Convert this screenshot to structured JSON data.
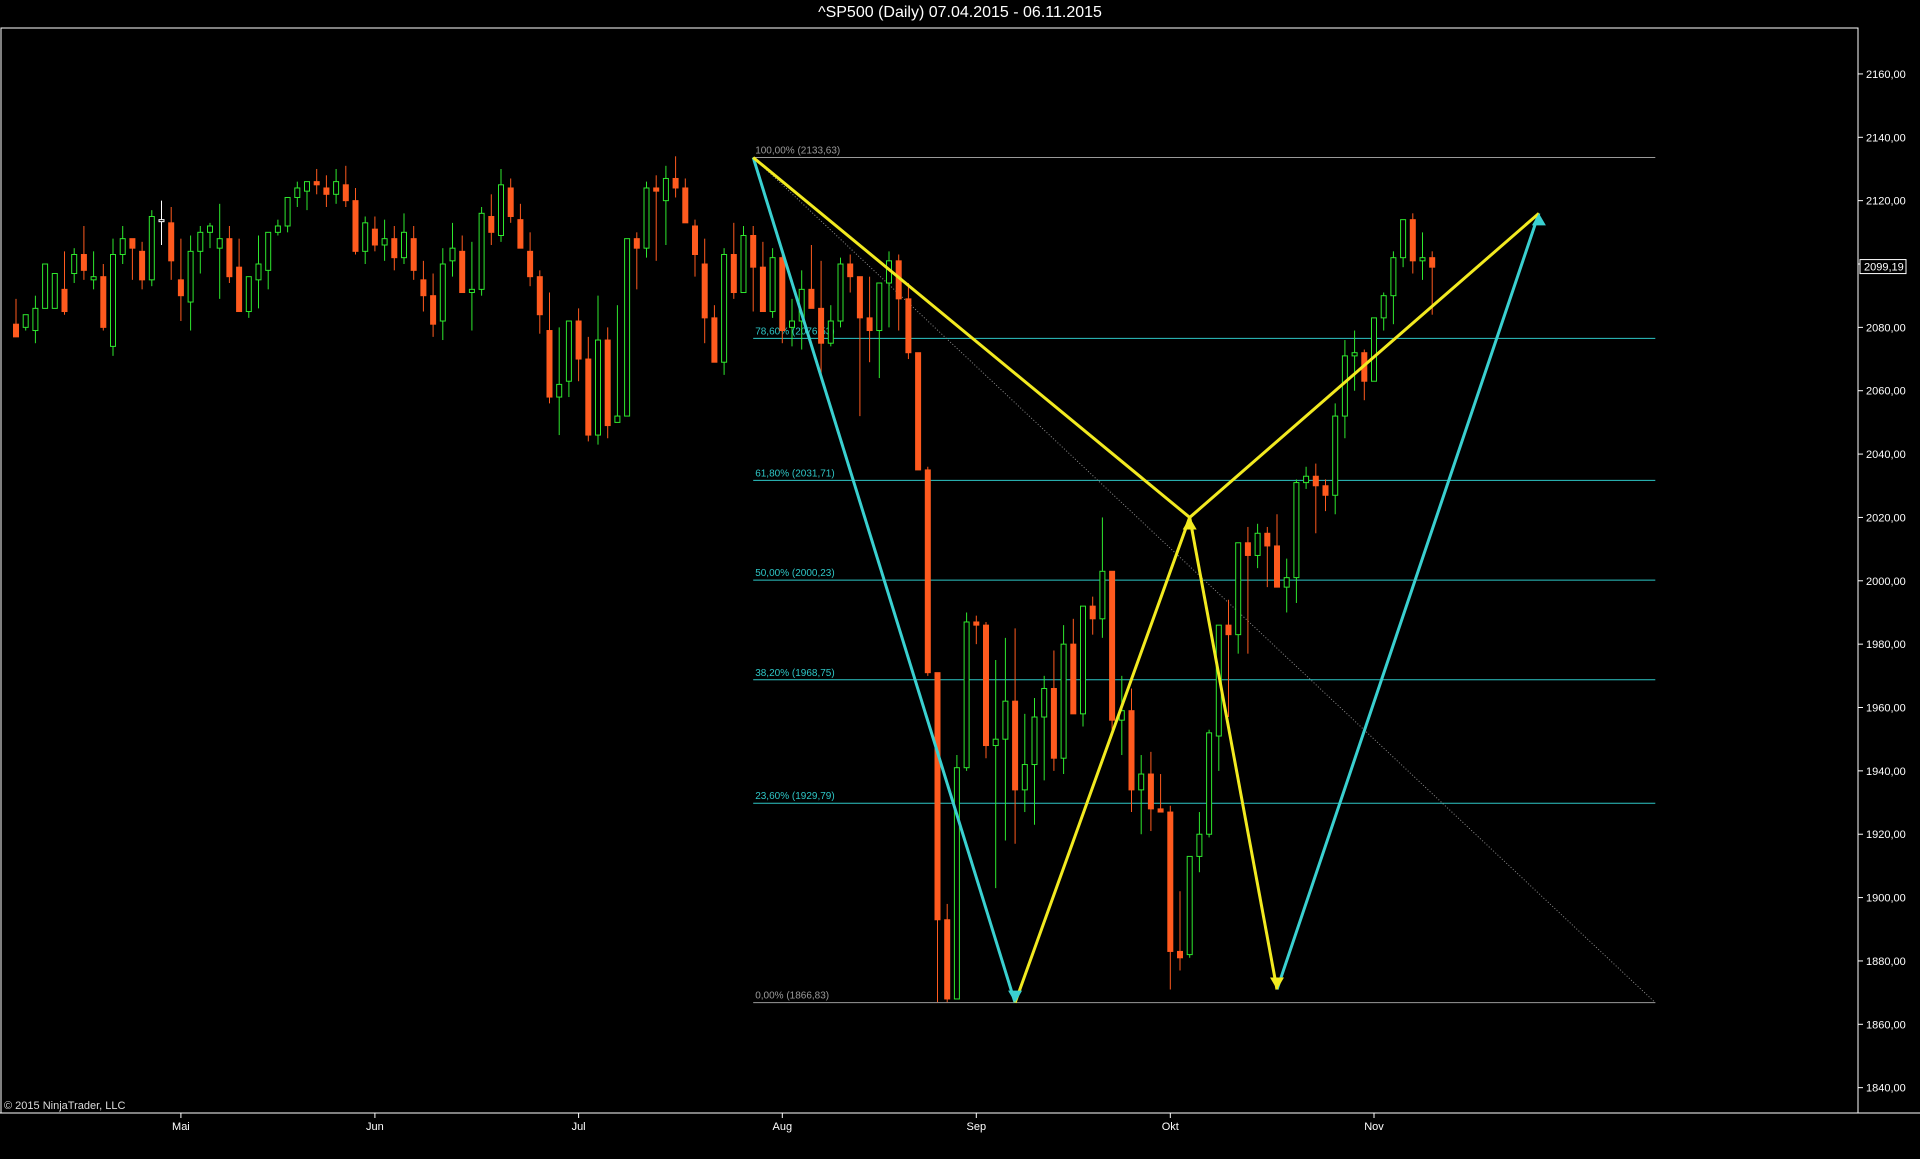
{
  "header": {
    "title": "^SP500 (Daily)  07.04.2015 - 06.11.2015"
  },
  "footer": {
    "copyright": "© 2015 NinjaTrader, LLC"
  },
  "colors": {
    "background": "#000000",
    "up_candle": "#2ee82e",
    "down_candle": "#ff5a1e",
    "doji": "#ffffff",
    "fib_line": "#2ec6c6",
    "fib_extreme_line": "#9a9a9a",
    "pattern_xa": "#3ad0d0",
    "pattern_yellow": "#f2ea20",
    "trend_line": "#8a8a8a",
    "axis": "#ffffff"
  },
  "chart_data": {
    "type": "candlestick",
    "title": "^SP500 (Daily)  07.04.2015 - 06.11.2015",
    "ylim": [
      1830,
      2170
    ],
    "y_ticks": [
      "1840,00",
      "1860,00",
      "1880,00",
      "1900,00",
      "1920,00",
      "1940,00",
      "1960,00",
      "1980,00",
      "2000,00",
      "2020,00",
      "2040,00",
      "2060,00",
      "2080,00",
      "2100,00",
      "2120,00",
      "2140,00",
      "2160,00"
    ],
    "x_ticks": [
      {
        "label": "Mai",
        "bar": 17
      },
      {
        "label": "Jun",
        "bar": 37
      },
      {
        "label": "Jul",
        "bar": 58
      },
      {
        "label": "Aug",
        "bar": 79
      },
      {
        "label": "Sep",
        "bar": 99
      },
      {
        "label": "Okt",
        "bar": 119
      },
      {
        "label": "Nov",
        "bar": 140
      }
    ],
    "last_price_label": "2099,19",
    "last_price": 2099.19,
    "candles": [
      [
        2081,
        2089,
        2079,
        2077
      ],
      [
        2080,
        2082,
        2079,
        2084
      ],
      [
        2079,
        2090,
        2075,
        2086
      ],
      [
        2086,
        2098,
        2086,
        2100
      ],
      [
        2086,
        2096,
        2092,
        2097
      ],
      [
        2092,
        2104,
        2084,
        2085
      ],
      [
        2097,
        2105,
        2094,
        2103
      ],
      [
        2103,
        2112,
        2095,
        2098
      ],
      [
        2095,
        2104,
        2092,
        2096
      ],
      [
        2096,
        2100,
        2079,
        2080
      ],
      [
        2074,
        2108,
        2071,
        2103
      ],
      [
        2103,
        2112,
        2100,
        2108
      ],
      [
        2108,
        2104,
        2095,
        2105
      ],
      [
        2104,
        2107,
        2092,
        2095
      ],
      [
        2095,
        2117,
        2093,
        2115
      ],
      [
        2114,
        2120,
        2106,
        2114
      ],
      [
        2113,
        2118,
        2095,
        2101
      ],
      [
        2095,
        2108,
        2082,
        2090
      ],
      [
        2088,
        2109,
        2079,
        2104
      ],
      [
        2104,
        2112,
        2097,
        2110
      ],
      [
        2110,
        2113,
        2105,
        2112
      ],
      [
        2105,
        2119,
        2089,
        2108
      ],
      [
        2108,
        2112,
        2094,
        2096
      ],
      [
        2099,
        2108,
        2090,
        2085
      ],
      [
        2085,
        2096,
        2083,
        2096
      ],
      [
        2095,
        2109,
        2086,
        2100
      ],
      [
        2098,
        2102,
        2092,
        2110
      ],
      [
        2110,
        2114,
        2109,
        2112
      ],
      [
        2112,
        2118,
        2110,
        2121
      ],
      [
        2121,
        2126,
        2118,
        2124
      ],
      [
        2123,
        2126,
        2117,
        2126
      ],
      [
        2126,
        2130,
        2122,
        2125
      ],
      [
        2124,
        2128,
        2118,
        2122
      ],
      [
        2122,
        2130,
        2119,
        2126
      ],
      [
        2125,
        2131,
        2118,
        2120
      ],
      [
        2120,
        2124,
        2103,
        2104
      ],
      [
        2104,
        2115,
        2100,
        2113
      ],
      [
        2111,
        2115,
        2104,
        2106
      ],
      [
        2106,
        2114,
        2101,
        2108
      ],
      [
        2108,
        2112,
        2098,
        2102
      ],
      [
        2102,
        2116,
        2100,
        2110
      ],
      [
        2108,
        2112,
        2095,
        2098
      ],
      [
        2095,
        2101,
        2085,
        2090
      ],
      [
        2090,
        2097,
        2077,
        2081
      ],
      [
        2082,
        2105,
        2076,
        2100
      ],
      [
        2101,
        2113,
        2096,
        2105
      ],
      [
        2104,
        2109,
        2095,
        2091
      ],
      [
        2091,
        2107,
        2079,
        2092
      ],
      [
        2092,
        2118,
        2090,
        2116
      ],
      [
        2115,
        2122,
        2106,
        2110
      ],
      [
        2109,
        2130,
        2107,
        2125
      ],
      [
        2124,
        2127,
        2113,
        2115
      ],
      [
        2114,
        2119,
        2105,
        2105
      ],
      [
        2104,
        2110,
        2093,
        2096
      ],
      [
        2096,
        2098,
        2078,
        2084
      ],
      [
        2079,
        2091,
        2056,
        2058
      ],
      [
        2058,
        2080,
        2046,
        2062
      ],
      [
        2063,
        2079,
        2058,
        2082
      ],
      [
        2082,
        2086,
        2063,
        2070
      ],
      [
        2070,
        2077,
        2044,
        2046
      ],
      [
        2046,
        2090,
        2043,
        2076
      ],
      [
        2076,
        2080,
        2045,
        2049
      ],
      [
        2050,
        2087,
        2052,
        2052
      ],
      [
        2052,
        2108,
        2052,
        2108
      ],
      [
        2108,
        2110,
        2092,
        2105
      ],
      [
        2105,
        2126,
        2102,
        2124
      ],
      [
        2124,
        2128,
        2101,
        2123
      ],
      [
        2120,
        2131,
        2106,
        2127
      ],
      [
        2127,
        2134,
        2121,
        2124
      ],
      [
        2124,
        2127,
        2113,
        2113
      ],
      [
        2112,
        2114,
        2096,
        2103
      ],
      [
        2100,
        2108,
        2075,
        2083
      ],
      [
        2083,
        2087,
        2071,
        2069
      ],
      [
        2069,
        2105,
        2065,
        2103
      ],
      [
        2103,
        2113,
        2089,
        2091
      ],
      [
        2091,
        2112,
        2097,
        2109
      ],
      [
        2109,
        2112,
        2085,
        2099
      ],
      [
        2099,
        2107,
        2086,
        2085
      ],
      [
        2085,
        2105,
        2083,
        2102
      ],
      [
        2102,
        2104,
        2075,
        2079
      ],
      [
        2080,
        2089,
        2074,
        2082
      ],
      [
        2082,
        2098,
        2073,
        2092
      ],
      [
        2092,
        2106,
        2086,
        2086
      ],
      [
        2086,
        2101,
        2065,
        2075
      ],
      [
        2075,
        2087,
        2074,
        2082
      ],
      [
        2082,
        2102,
        2080,
        2100
      ],
      [
        2100,
        2103,
        2091,
        2096
      ],
      [
        2096,
        2090,
        2052,
        2083
      ],
      [
        2083,
        2096,
        2069,
        2079
      ],
      [
        2079,
        2092,
        2064,
        2094
      ],
      [
        2094,
        2104,
        2080,
        2101
      ],
      [
        2101,
        2103,
        2079,
        2089
      ],
      [
        2089,
        2094,
        2070,
        2072
      ],
      [
        2072,
        2071,
        2035,
        2035
      ],
      [
        2035,
        2036,
        1970,
        1971
      ],
      [
        1971,
        1965,
        1867,
        1893
      ],
      [
        1893,
        1898,
        1867,
        1868
      ],
      [
        1868,
        1945,
        1869,
        1941
      ],
      [
        1941,
        1990,
        1940,
        1987
      ],
      [
        1987,
        1989,
        1980,
        1986
      ],
      [
        1986,
        1987,
        1944,
        1948
      ],
      [
        1948,
        1975,
        1903,
        1950
      ],
      [
        1950,
        1982,
        1918,
        1962
      ],
      [
        1962,
        1985,
        1917,
        1934
      ],
      [
        1934,
        1958,
        1927,
        1942
      ],
      [
        1942,
        1963,
        1923,
        1957
      ],
      [
        1957,
        1970,
        1937,
        1966
      ],
      [
        1966,
        1978,
        1940,
        1944
      ],
      [
        1944,
        1986,
        1939,
        1980
      ],
      [
        1980,
        1988,
        1962,
        1958
      ],
      [
        1958,
        1985,
        1954,
        1992
      ],
      [
        1992,
        1995,
        1983,
        1988
      ],
      [
        1988,
        2020,
        1982,
        2003
      ],
      [
        2003,
        2002,
        1952,
        1956
      ],
      [
        1956,
        1970,
        1945,
        1959
      ],
      [
        1959,
        1966,
        1927,
        1934
      ],
      [
        1934,
        1945,
        1920,
        1939
      ],
      [
        1939,
        1946,
        1921,
        1928
      ],
      [
        1928,
        1939,
        1928,
        1927
      ],
      [
        1927,
        1929,
        1871,
        1883
      ],
      [
        1883,
        1902,
        1877,
        1881
      ],
      [
        1882,
        1913,
        1881,
        1913
      ],
      [
        1913,
        1927,
        1908,
        1920
      ],
      [
        1920,
        1953,
        1919,
        1952
      ],
      [
        1951,
        1986,
        1940,
        1986
      ],
      [
        1986,
        1994,
        1957,
        1983
      ],
      [
        1983,
        2005,
        1977,
        2012
      ],
      [
        2012,
        2017,
        1977,
        2008
      ],
      [
        2008,
        2018,
        2004,
        2015
      ],
      [
        2015,
        2017,
        1998,
        2011
      ],
      [
        2011,
        2021,
        1998,
        1998
      ],
      [
        1998,
        2007,
        1990,
        2001
      ],
      [
        2001,
        2032,
        1993,
        2031
      ],
      [
        2031,
        2036,
        2029,
        2033
      ],
      [
        2033,
        2037,
        2015,
        2030
      ],
      [
        2030,
        2032,
        2022,
        2027
      ],
      [
        2027,
        2056,
        2021,
        2052
      ],
      [
        2052,
        2076,
        2045,
        2071
      ],
      [
        2071,
        2079,
        2060,
        2072
      ],
      [
        2072,
        2073,
        2057,
        2063
      ],
      [
        2063,
        2082,
        2064,
        2083
      ],
      [
        2083,
        2091,
        2079,
        2090
      ],
      [
        2090,
        2104,
        2081,
        2102
      ],
      [
        2102,
        2112,
        2099,
        2114
      ],
      [
        2114,
        2116,
        2097,
        2101
      ],
      [
        2101,
        2110,
        2095,
        2102
      ],
      [
        2102,
        2104,
        2084,
        2099
      ]
    ],
    "fibonacci": [
      {
        "label": "100,00% (2133,63)",
        "value": 2133.63
      },
      {
        "label": "78,60% (2076,53)",
        "value": 2076.53
      },
      {
        "label": "61,80% (2031,71)",
        "value": 2031.71
      },
      {
        "label": "50,00% (2000,23)",
        "value": 2000.23
      },
      {
        "label": "38,20% (1968,75)",
        "value": 1968.75
      },
      {
        "label": "23,60% (1929,79)",
        "value": 1929.79
      },
      {
        "label": "0,00% (1866,83)",
        "value": 1866.83
      }
    ],
    "fib_x_range": [
      76,
      169
    ],
    "trend_line": {
      "from": [
        76,
        2133.63
      ],
      "to": [
        169,
        1866.83
      ]
    },
    "pattern_xa_legs": [
      [
        [
          76,
          2133.63
        ],
        [
          103,
          1866.83
        ]
      ],
      [
        [
          130,
          1871
        ],
        [
          157,
          2116
        ]
      ]
    ],
    "pattern_yellow_legs": [
      [
        [
          76,
          2133.63
        ],
        [
          121,
          2020
        ]
      ],
      [
        [
          103,
          1866.83
        ],
        [
          121,
          2020
        ]
      ],
      [
        [
          121,
          2020
        ],
        [
          130,
          1871
        ]
      ],
      [
        [
          121,
          2020
        ],
        [
          157,
          2116
        ]
      ]
    ]
  }
}
